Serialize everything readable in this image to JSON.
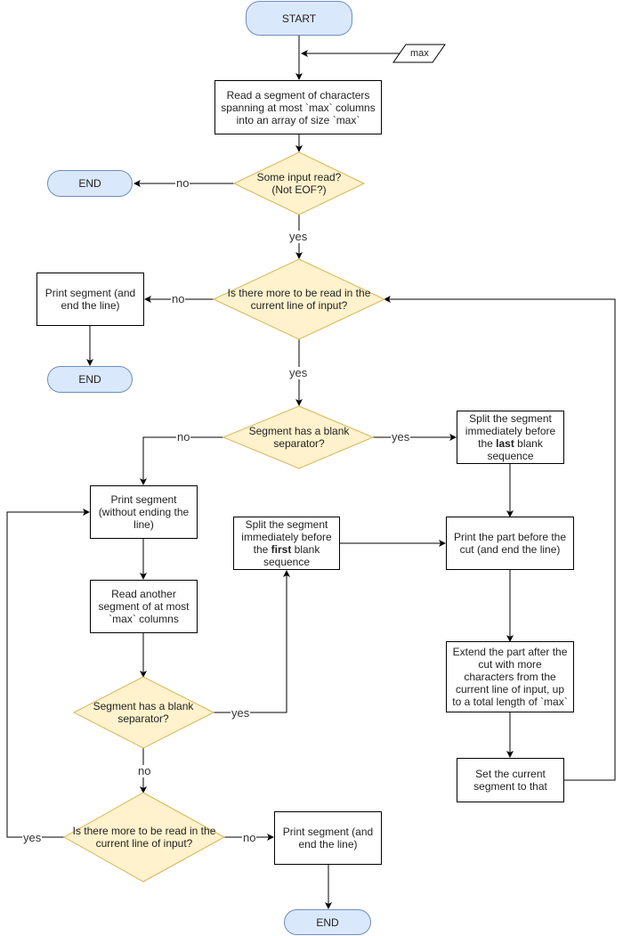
{
  "diagram": {
    "type": "flowchart",
    "colors": {
      "terminal_fill": "#dae8fc",
      "terminal_stroke": "#6c8ebf",
      "decision_fill": "#fff2cc",
      "decision_stroke": "#d6b656"
    },
    "nodes": {
      "start": "START",
      "input_max": "max",
      "read_segment": "Read a segment of characters spanning at most `max` columns into an array of size `max`",
      "some_input_read": "Some input read? (Not EOF?)",
      "end_1": "END",
      "more_in_line_1": "Is there more to be read in the current line of input?",
      "print_end_line_1": "Print segment (and end the line)",
      "end_2": "END",
      "blank_sep_1": "Segment has a blank separator?",
      "split_last_pre": "Split the segment immediately before the ",
      "split_last_bold": "last",
      "split_last_post": " blank sequence",
      "print_no_end": "Print segment (without ending the line)",
      "read_another": "Read another segment of at most `max` columns",
      "split_first_pre": "Split the segment immediately before the ",
      "split_first_bold": "first",
      "split_first_post": " blank sequence",
      "print_part_before": "Print the part before the cut (and end the line)",
      "extend_part": "Extend the part after the cut with more characters from the current line of input, up to a total length of `max`",
      "blank_sep_2": "Segment has a blank separator?",
      "set_current": "Set the current segment to that",
      "more_in_line_2": "Is there more to be read in the current line of input?",
      "print_end_line_2": "Print segment (and end the line)",
      "end_3": "END"
    },
    "edge_labels": {
      "no_eof": "no",
      "yes_read": "yes",
      "no_more_1": "no",
      "yes_more_1": "yes",
      "no_blank_1": "no",
      "yes_blank_1": "yes",
      "yes_blank_2": "yes",
      "no_blank_2": "no",
      "yes_more_2": "yes",
      "no_more_2": "no"
    }
  }
}
